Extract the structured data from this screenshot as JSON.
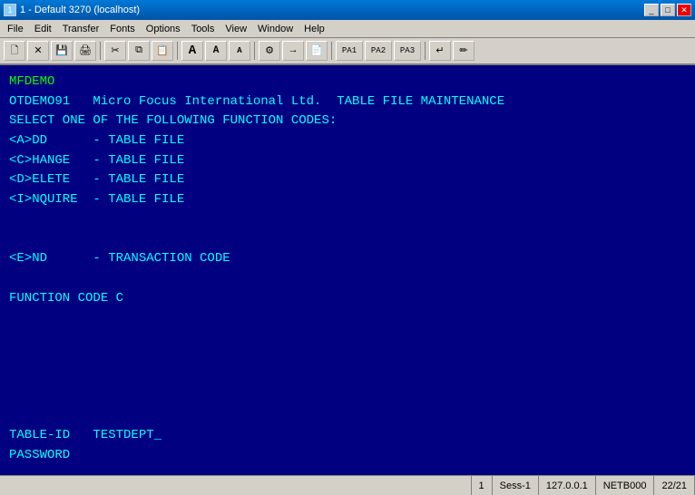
{
  "titlebar": {
    "title": "1 - Default 3270 (localhost)",
    "icon": "🖥"
  },
  "menubar": {
    "items": [
      "File",
      "Edit",
      "Transfer",
      "Fonts",
      "Options",
      "Tools",
      "View",
      "Window",
      "Help"
    ]
  },
  "toolbar": {
    "buttons": [
      {
        "name": "new",
        "icon": "🗋"
      },
      {
        "name": "close",
        "icon": "✕"
      },
      {
        "name": "save",
        "icon": "💾"
      },
      {
        "name": "print",
        "icon": "🖨"
      },
      {
        "name": "cut",
        "icon": "✂"
      },
      {
        "name": "copy",
        "icon": "⧉"
      },
      {
        "name": "paste",
        "icon": "📋"
      },
      {
        "name": "font-large",
        "icon": "A"
      },
      {
        "name": "font-medium",
        "icon": "A"
      },
      {
        "name": "font-small",
        "icon": "A"
      },
      {
        "name": "tools",
        "icon": "⚙"
      },
      {
        "name": "arrow",
        "icon": "→"
      },
      {
        "name": "clipboard2",
        "icon": "📄"
      },
      {
        "name": "pa1",
        "label": "PA1"
      },
      {
        "name": "pa2",
        "label": "PA2"
      },
      {
        "name": "pa3",
        "label": "PA3"
      },
      {
        "name": "enter",
        "icon": "↵"
      },
      {
        "name": "pencil",
        "icon": "✏"
      }
    ]
  },
  "terminal": {
    "line1": "MFDEMO",
    "line2": "OTDEMO91   Micro Focus International Ltd.  TABLE FILE MAINTENANCE",
    "line3": "",
    "line4": "SELECT ONE OF THE FOLLOWING FUNCTION CODES:",
    "line5": "",
    "line6": "<A>DD      - TABLE FILE",
    "line7": "<C>HANGE   - TABLE FILE",
    "line8": "<D>ELETE   - TABLE FILE",
    "line9": "<I>NQUIRE  - TABLE FILE",
    "line10": "",
    "line11": "",
    "line12": "<E>ND      - TRANSACTION CODE",
    "line13": "",
    "line14": "FUNCTION CODE C",
    "line15": "",
    "line16": "",
    "line17": "",
    "line18": "",
    "line19": "",
    "line20": "",
    "line21": "TABLE-ID   TESTDEPT_",
    "line22": "PASSWORD"
  },
  "statusbar": {
    "col1": "1",
    "col2": "Sess-1",
    "col3": "127.0.0.1",
    "col4": "NETB000",
    "col5": "22/21"
  }
}
